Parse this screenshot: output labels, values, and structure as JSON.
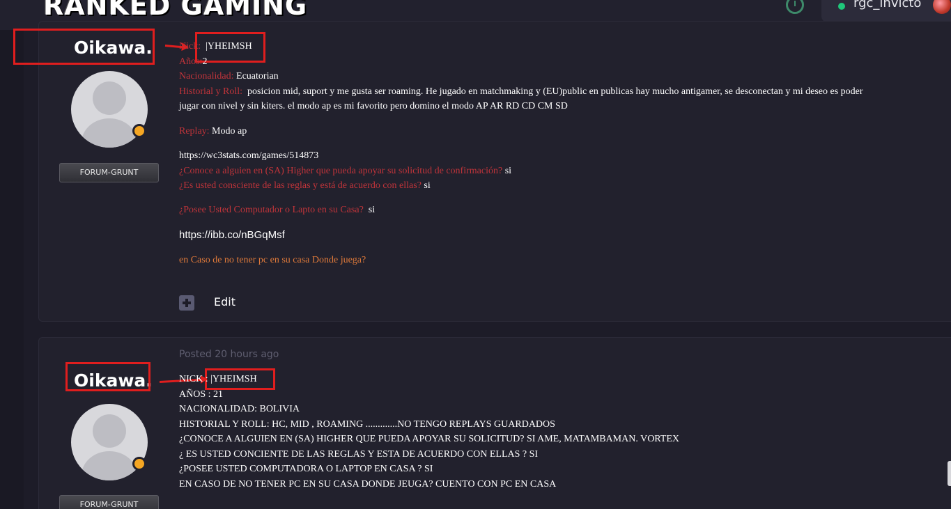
{
  "header": {
    "logo_text": "RANKED GAMING",
    "username": "rgc_invicto",
    "icons": {
      "clock": "clock-icon",
      "online": "online-dot-icon",
      "avatar": "user-avatar"
    }
  },
  "posts": [
    {
      "author": "Oikawa.",
      "badge": "FORUM-GRUNT",
      "lines": {
        "nick_label": "Nick:",
        "nick_value": "|YHEIMSH",
        "age_label": "Años:",
        "age_value": "2",
        "nationality_label": "Nacionalidad:",
        "nationality_value": "Ecuatorian",
        "history_label": "Historial y Roll:",
        "history_value_1": "posicion mid, suport y me gusta ser roaming. He jugado en matchmaking y (EU)public en publicas hay mucho antigamer, se desconectan y mi deseo es poder",
        "history_value_2": "jugar con nivel y sin kiters. el modo ap es mi favorito pero domino el modo AP AR RD CD CM SD",
        "replay_label": "Replay:",
        "replay_value": "Modo ap",
        "stats_link": "https://wc3stats.com/games/514873",
        "q_know_label": "¿Conoce a alguien en (SA) Higher  que pueda apoyar su solicitud de confirmación?",
        "q_know_value": "si",
        "q_rules_label": "¿Es usted consciente de las reglas y está de acuerdo con ellas?",
        "q_rules_value": "si",
        "q_pc_label": "¿Posee Usted Computador o Lapto en su Casa?",
        "q_pc_value": "si",
        "img_link": "https://ibb.co/nBGqMsf",
        "q_nopc": "en Caso de no tener pc en su casa Donde juega?"
      },
      "edit_label": "Edit"
    },
    {
      "author": "Oikawa.",
      "badge": "FORUM-GRUNT",
      "posted": "Posted 20 hours ago",
      "lines": {
        "nick_label": "NICK :",
        "nick_value": "|YHEIMSH",
        "age": "AÑOS :  21",
        "nationality": "NACIONALIDAD: BOLIVIA",
        "history": "HISTORIAL Y ROLL:  HC, MID , ROAMING .............NO TENGO REPLAYS GUARDADOS",
        "q_know": "¿CONOCE A ALGUIEN EN (SA) HIGHER QUE PUEDA APOYAR SU SOLICITUD?   SI     AME, MATAMBAMAN. VORTEX",
        "q_rules": "¿ ES USTED CONCIENTE DE LAS REGLAS Y ESTA DE ACUERDO CON ELLAS ?    SI",
        "q_pc": "¿POSEE USTED COMPUTADORA O LAPTOP EN CASA ?   SI",
        "q_nopc": "EN CASO DE NO TENER PC EN SU CASA DONDE JEUGA?    CUENTO CON PC EN CASA"
      }
    }
  ],
  "colors": {
    "background": "#1d1c28",
    "label_red": "#c0343a",
    "annotation_red": "#e01e1e",
    "status_orange": "#f5a623",
    "online_green": "#1fc77a"
  }
}
